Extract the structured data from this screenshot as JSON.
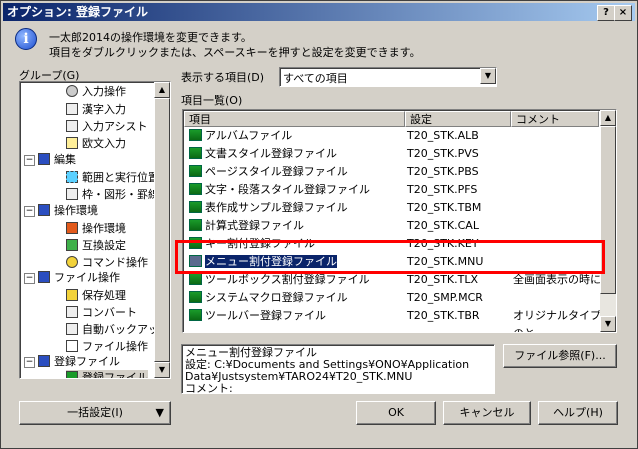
{
  "window": {
    "title": "オプション: 登録ファイル",
    "help_btn": "?",
    "close_btn": "×"
  },
  "info": {
    "icon": "info-icon",
    "line1": "一太郎2014の操作環境を変更できます。",
    "line2": "項目をダブルクリックまたは、スペースキーを押すと設定を変更できます。"
  },
  "group": {
    "label": "グループ(G)",
    "items": [
      {
        "label": "入力操作",
        "icon": "input-operation-icon"
      },
      {
        "label": "漢字入力",
        "icon": "kanji-input-icon"
      },
      {
        "label": "入力アシスト",
        "icon": "input-assist-icon"
      },
      {
        "label": "欧文入力",
        "icon": "roman-input-icon"
      },
      {
        "label": "編集",
        "icon": "edit-category-icon"
      },
      {
        "label": "範囲と実行位置",
        "icon": "range-icon"
      },
      {
        "label": "枠・図形・罫線",
        "icon": "frame-shape-icon"
      },
      {
        "label": "操作環境",
        "icon": "env-category-icon"
      },
      {
        "label": "操作環境",
        "icon": "operation-env-icon"
      },
      {
        "label": "互換設定",
        "icon": "compat-icon"
      },
      {
        "label": "コマンド操作",
        "icon": "command-icon"
      },
      {
        "label": "ファイル操作",
        "icon": "file-category-icon"
      },
      {
        "label": "保存処理",
        "icon": "save-process-icon"
      },
      {
        "label": "コンバート",
        "icon": "convert-icon"
      },
      {
        "label": "自動バックアップ",
        "icon": "auto-backup-icon"
      },
      {
        "label": "ファイル操作",
        "icon": "file-operation-icon"
      },
      {
        "label": "登録ファイル",
        "icon": "registry-category-icon"
      },
      {
        "label": "登録ファイル",
        "icon": "registry-file-icon"
      }
    ]
  },
  "display": {
    "label": "表示する項目(D)",
    "value": "すべての項目"
  },
  "list": {
    "label": "項目一覧(O)",
    "columns": [
      "項目",
      "設定",
      "コメント"
    ],
    "rows": [
      {
        "item": "アルバムファイル",
        "setting": "T20_STK.ALB",
        "comment": ""
      },
      {
        "item": "文書スタイル登録ファイル",
        "setting": "T20_STK.PVS",
        "comment": ""
      },
      {
        "item": "ページスタイル登録ファイル",
        "setting": "T20_STK.PBS",
        "comment": ""
      },
      {
        "item": "文字・段落スタイル登録ファイル",
        "setting": "T20_STK.PFS",
        "comment": ""
      },
      {
        "item": "表作成サンプル登録ファイル",
        "setting": "T20_STK.TBM",
        "comment": ""
      },
      {
        "item": "計算式登録ファイル",
        "setting": "T20_STK.CAL",
        "comment": ""
      },
      {
        "item": "キー割付登録ファイル",
        "setting": "T20_STK.KEY",
        "comment": ""
      },
      {
        "item": "メニュー割付登録ファイル",
        "setting": "T20_STK.MNU",
        "comment": ""
      },
      {
        "item": "ツールボックス割付登録ファイル",
        "setting": "T20_STK.TLX",
        "comment": "全画面表示の時に"
      },
      {
        "item": "システムマクロ登録ファイル",
        "setting": "T20_SMP.MCR",
        "comment": ""
      },
      {
        "item": "ツールバー登録ファイル",
        "setting": "T20_STK.TBR",
        "comment": "オリジナルタイプのと"
      }
    ]
  },
  "description": {
    "line1": "メニュー割付登録ファイル",
    "line2": "設定:    C:¥Documents and Settings¥ONO¥Application",
    "line3": "Data¥Justsystem¥TARO24¥T20_STK.MNU",
    "line4": "コメント:"
  },
  "buttons": {
    "file_ref": "ファイル参照(F)...",
    "batch": "一括設定(I)",
    "ok": "OK",
    "cancel": "キャンセル",
    "help": "ヘルプ(H)"
  },
  "colors": {
    "selection": "#0a246a",
    "highlight_box": "#ff0000"
  }
}
